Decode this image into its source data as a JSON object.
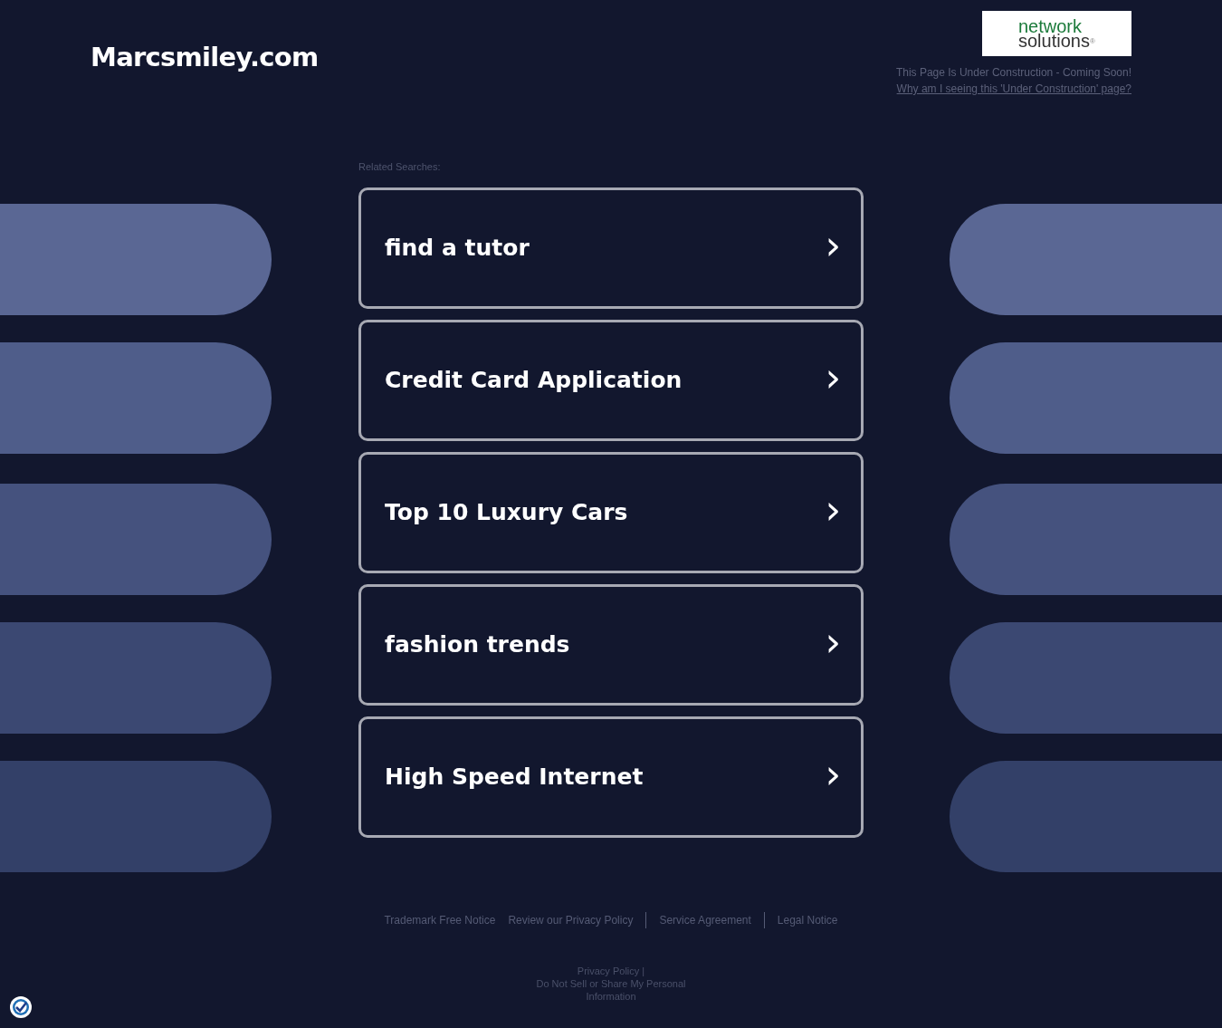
{
  "site_title": "Marcsmiley.com",
  "logo": {
    "line_1": "network",
    "line_2": "solutions",
    "mark": "®"
  },
  "notice": "This Page Is Under Construction - Coming Soon!",
  "notice_link": "Why am I seeing this 'Under Construction' page?",
  "related_label": "Related Searches:",
  "searches": [
    {
      "label": "find a tutor",
      "arrow": "›"
    },
    {
      "label": "Credit Card Application",
      "arrow": "›"
    },
    {
      "label": "Top 10 Luxury Cars",
      "arrow": "›"
    },
    {
      "label": "fashion trends",
      "arrow": "›"
    },
    {
      "label": "High Speed Internet",
      "arrow": "›"
    }
  ],
  "footer_links": [
    "Trademark Free Notice",
    "Review our Privacy Policy",
    "Service Agreement",
    "Legal Notice"
  ],
  "privacy": {
    "link": "Privacy Policy |",
    "do_not_sell": "Do Not Sell or Share My Personal Information"
  }
}
